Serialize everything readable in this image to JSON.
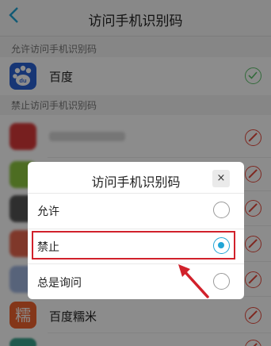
{
  "header": {
    "title": "访问手机识别码",
    "back_icon": "chevron-left-icon"
  },
  "allowed_section": {
    "label": "允许访问手机识别码"
  },
  "allowed_apps": [
    {
      "name": "百度",
      "icon_text": "du",
      "status": "allowed"
    }
  ],
  "denied_section": {
    "label": "禁止访问手机识别码"
  },
  "denied_apps": [
    {
      "name": "",
      "status": "denied"
    },
    {
      "name": "",
      "status": "denied"
    },
    {
      "name": "",
      "status": "denied"
    },
    {
      "name": "",
      "status": "denied"
    },
    {
      "name": "",
      "status": "denied"
    },
    {
      "name": "百度糯米",
      "icon_text": "糯",
      "status": "denied"
    }
  ],
  "dialog": {
    "title": "访问手机识别码",
    "close_label": "×",
    "options": [
      {
        "label": "允许",
        "selected": false
      },
      {
        "label": "禁止",
        "selected": true
      },
      {
        "label": "总是询问",
        "selected": false
      }
    ]
  },
  "colors": {
    "accent": "#21a5d6",
    "allow": "#5cc26a",
    "deny": "#e64a3c",
    "highlight": "#d1212b"
  }
}
